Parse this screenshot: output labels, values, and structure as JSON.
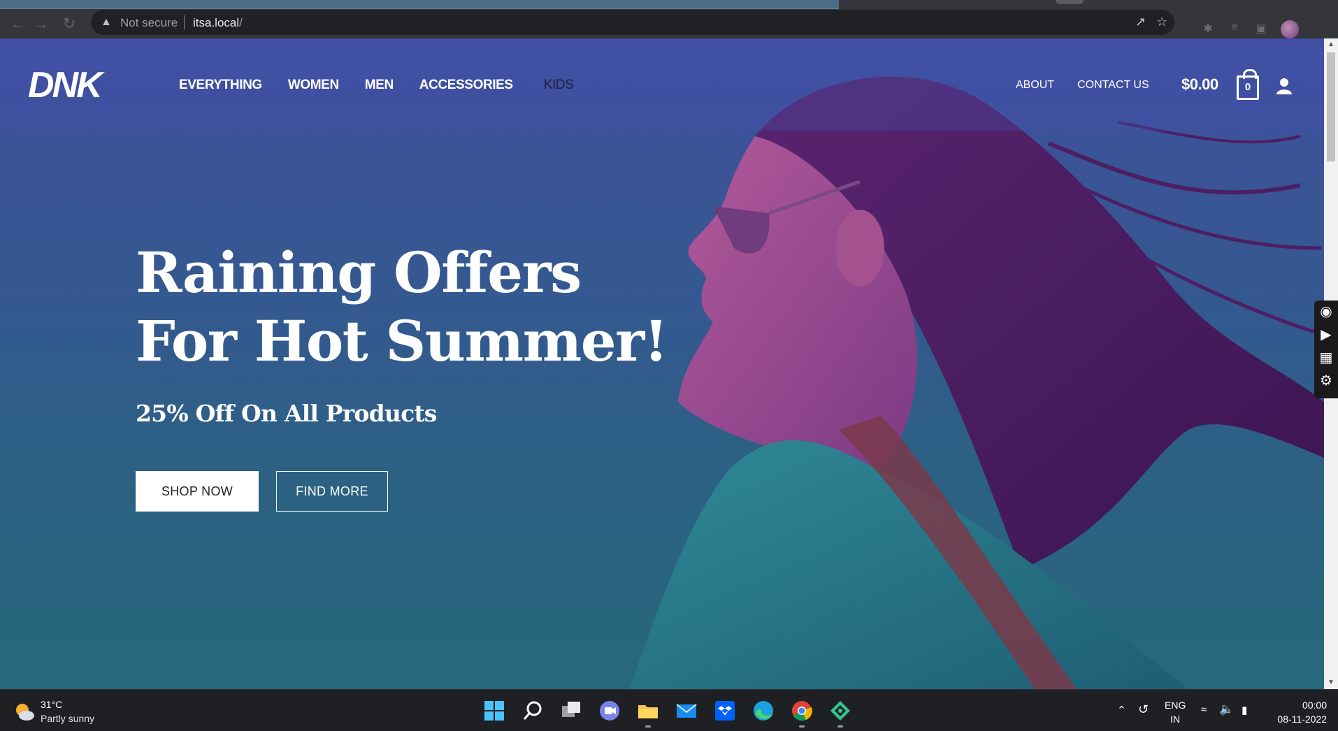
{
  "browser": {
    "security_label": "Not secure",
    "url_host": "itsa.local",
    "url_path": "/"
  },
  "site": {
    "nav": {
      "main": [
        "EVERYTHING",
        "WOMEN",
        "MEN",
        "ACCESSORIES",
        "KIDS"
      ],
      "secondary": [
        "ABOUT",
        "CONTACT US"
      ]
    },
    "cart": {
      "total": "$0.00",
      "count": "0"
    }
  },
  "hero": {
    "title_line1": "Raining Offers",
    "title_line2": "For Hot Summer!",
    "subtitle": "25% Off On All Products",
    "shop_button": "SHOP NOW",
    "find_button": "FIND MORE"
  },
  "taskbar": {
    "weather_temp": "31°C",
    "weather_desc": "Partly sunny",
    "lang_top": "ENG",
    "lang_bottom": "IN",
    "time": "00:00",
    "date": "08-11-2022"
  },
  "colors": {
    "hero_top": "#3f4fa3",
    "hero_bottom": "#27687c",
    "button_fill": "#ffffff"
  }
}
